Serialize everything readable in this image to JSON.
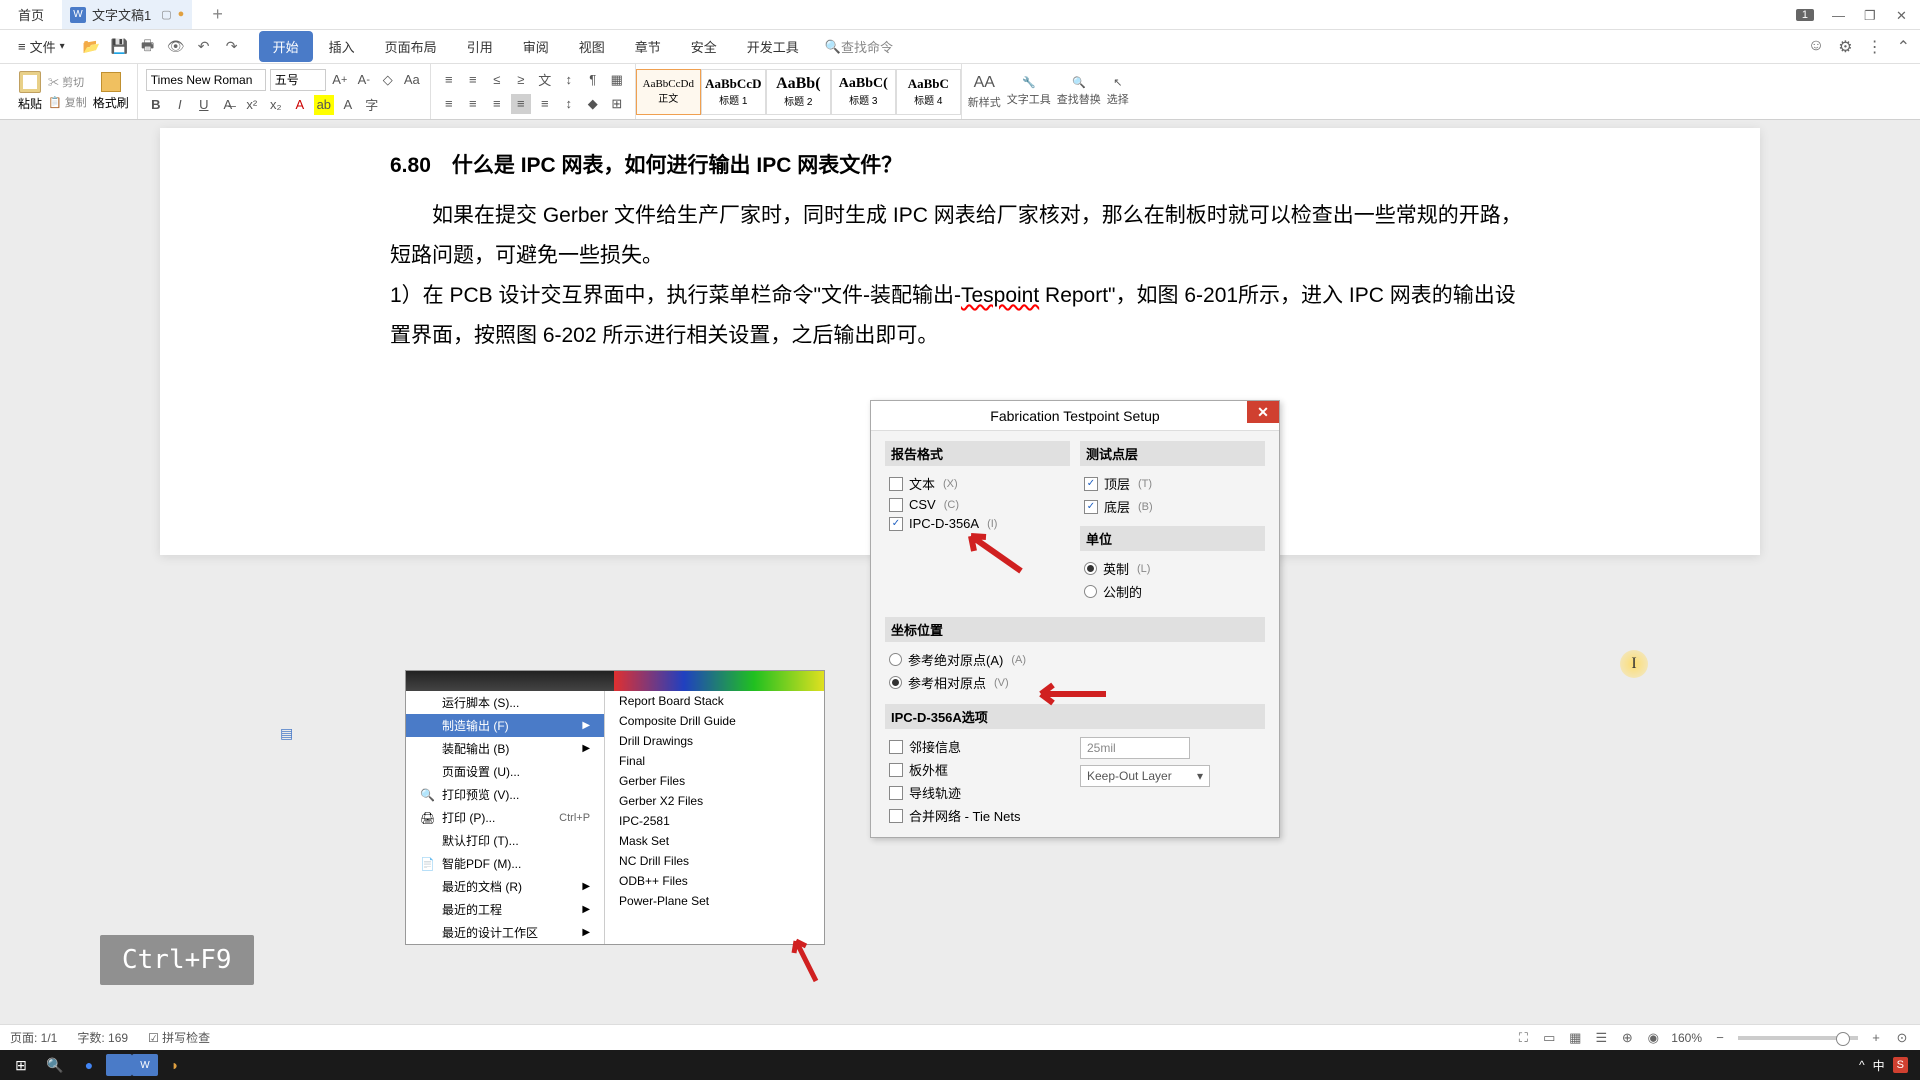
{
  "titlebar": {
    "home": "首页",
    "doc_icon": "W",
    "doc_name": "文字文稿1",
    "badge": "1"
  },
  "menubar": {
    "file": "文件",
    "tabs": [
      "开始",
      "插入",
      "页面布局",
      "引用",
      "审阅",
      "视图",
      "章节",
      "安全",
      "开发工具"
    ],
    "search_placeholder": "查找命令"
  },
  "ribbon": {
    "paste": "粘贴",
    "cut": "剪切",
    "copy": "复制",
    "format_painter": "格式刷",
    "font_name": "Times New Roman",
    "font_size": "五号",
    "styles": [
      {
        "preview": "AaBbCcDd",
        "name": "正文"
      },
      {
        "preview": "AaBbCcD",
        "name": "标题 1"
      },
      {
        "preview": "AaBb(",
        "name": "标题 2"
      },
      {
        "preview": "AaBbC(",
        "name": "标题 3"
      },
      {
        "preview": "AaBbC",
        "name": "标题 4"
      }
    ],
    "new_style": "新样式",
    "text_tools": "文字工具",
    "find_replace": "查找替换",
    "select": "选择"
  },
  "document": {
    "title": "6.80 什么是 IPC 网表，如何进行输出 IPC 网表文件？",
    "para1": "如果在提交 Gerber 文件给生产厂家时，同时生成 IPC 网表给厂家核对，那么在制板时就可以检查出一些常规的开路，短路问题，可避免一些损失。",
    "para2a": "1）在 PCB 设计交互界面中，执行菜单栏命令\"文件-装配输出-",
    "para2b": "Tespoint",
    "para2c": " Report\"，如图 6-201所示，进入 IPC 网表的输出设置界面，按照图 6-202 所示进行相关设置，之后输出即可。"
  },
  "menu_img": {
    "items_left": [
      {
        "label": "运行脚本 (S)...",
        "icon": ""
      },
      {
        "label": "制造输出 (F)",
        "hl": true,
        "arrow": true
      },
      {
        "label": "装配输出 (B)",
        "arrow": true
      },
      {
        "label": "页面设置 (U)..."
      },
      {
        "label": "打印预览 (V)...",
        "icon": "🔍"
      },
      {
        "label": "打印 (P)...",
        "icon": "🖨",
        "shortcut": "Ctrl+P"
      },
      {
        "label": "默认打印 (T)..."
      },
      {
        "label": "智能PDF (M)...",
        "icon": "📄"
      },
      {
        "label": "最近的文档 (R)",
        "arrow": true
      },
      {
        "label": "最近的工程",
        "arrow": true
      },
      {
        "label": "最近的设计工作区",
        "arrow": true
      }
    ],
    "items_right": [
      "Report Board Stack",
      "Composite Drill Guide",
      "Drill Drawings",
      "Final",
      "Gerber Files",
      "Gerber X2 Files",
      "IPC-2581",
      "Mask Set",
      "NC Drill Files",
      "ODB++ Files",
      "Power-Plane Set"
    ]
  },
  "dialog": {
    "title": "Fabrication Testpoint Setup",
    "sec_format": "报告格式",
    "opt_text": "文本",
    "opt_text_hint": "(X)",
    "opt_csv": "CSV",
    "opt_csv_hint": "(C)",
    "opt_ipc": "IPC-D-356A",
    "opt_ipc_hint": "(I)",
    "sec_layer": "测试点层",
    "opt_top": "顶层",
    "opt_top_hint": "(T)",
    "opt_bot": "底层",
    "opt_bot_hint": "(B)",
    "sec_unit": "单位",
    "opt_imperial": "英制",
    "opt_imperial_hint": "(L)",
    "opt_metric": "公制的",
    "sec_coord": "坐标位置",
    "opt_abs": "参考绝对原点(A)",
    "opt_abs_hint": "(A)",
    "opt_rel": "参考相对原点",
    "opt_rel_hint": "(V)",
    "sec_ipcopt": "IPC-D-356A选项",
    "opt_adj": "邻接信息",
    "opt_board": "板外框",
    "opt_track": "导线轨迹",
    "opt_merge": "合并网络 - Tie Nets",
    "val_25mil": "25mil",
    "val_keepout": "Keep-Out Layer"
  },
  "shortcut": "Ctrl+F9",
  "statusbar": {
    "page": "页面: 1/1",
    "words": "字数: 169",
    "spell": "拼写检查",
    "zoom": "160%"
  },
  "taskbar": {
    "ime": "中",
    "sogou": "S"
  }
}
